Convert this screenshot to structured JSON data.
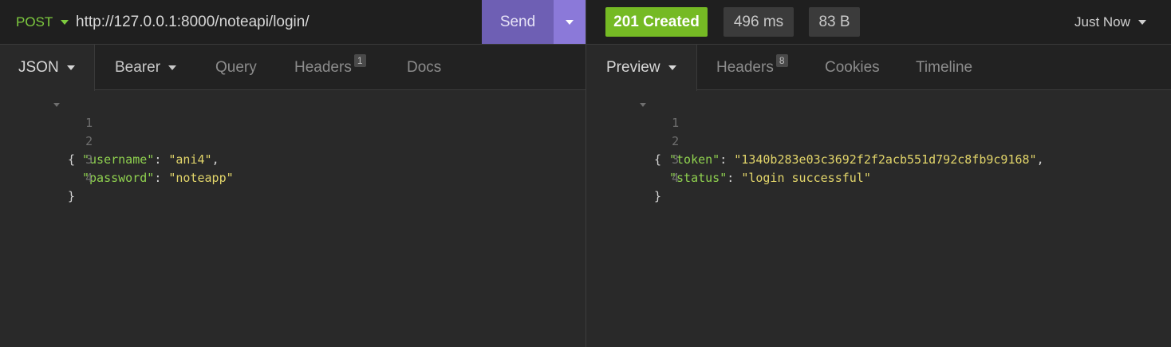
{
  "request": {
    "method": "POST",
    "url": "http://127.0.0.1:8000/noteapi/login/",
    "send_label": "Send",
    "tabs": [
      {
        "label": "JSON",
        "active": true,
        "dropdown": true
      },
      {
        "label": "Bearer",
        "dropdown": true
      },
      {
        "label": "Query"
      },
      {
        "label": "Headers",
        "count": "1"
      },
      {
        "label": "Docs"
      }
    ],
    "body": {
      "line_numbers": [
        "1",
        "2",
        "3",
        "4"
      ],
      "open_brace": "{",
      "close_brace": "}",
      "fields": [
        {
          "key": "\"username\"",
          "value": "\"ani4\""
        },
        {
          "key": "\"password\"",
          "value": "\"noteapp\""
        }
      ]
    }
  },
  "response": {
    "status": "201 Created",
    "time": "496 ms",
    "size": "83 B",
    "history": "Just Now",
    "tabs": [
      {
        "label": "Preview",
        "active": true,
        "dropdown": true
      },
      {
        "label": "Headers",
        "count": "8"
      },
      {
        "label": "Cookies"
      },
      {
        "label": "Timeline"
      }
    ],
    "body": {
      "line_numbers": [
        "1",
        "2",
        "3",
        "4"
      ],
      "open_brace": "{",
      "close_brace": "}",
      "fields": [
        {
          "key": "\"token\"",
          "value": "\"1340b283e03c3692f2f2acb551d792c8fb9c9168\""
        },
        {
          "key": "\"status\"",
          "value": "\"login successful\""
        }
      ]
    }
  },
  "colors": {
    "method": "#7ecb3f",
    "send": "#6e5fb4",
    "send_options": "#8b79d9",
    "status_ok": "#75ba24",
    "json_key": "#8fd14f",
    "json_string": "#e2d56a"
  },
  "icons": {
    "dropdown": "chevron-down-icon",
    "fold": "fold-arrow-icon"
  }
}
